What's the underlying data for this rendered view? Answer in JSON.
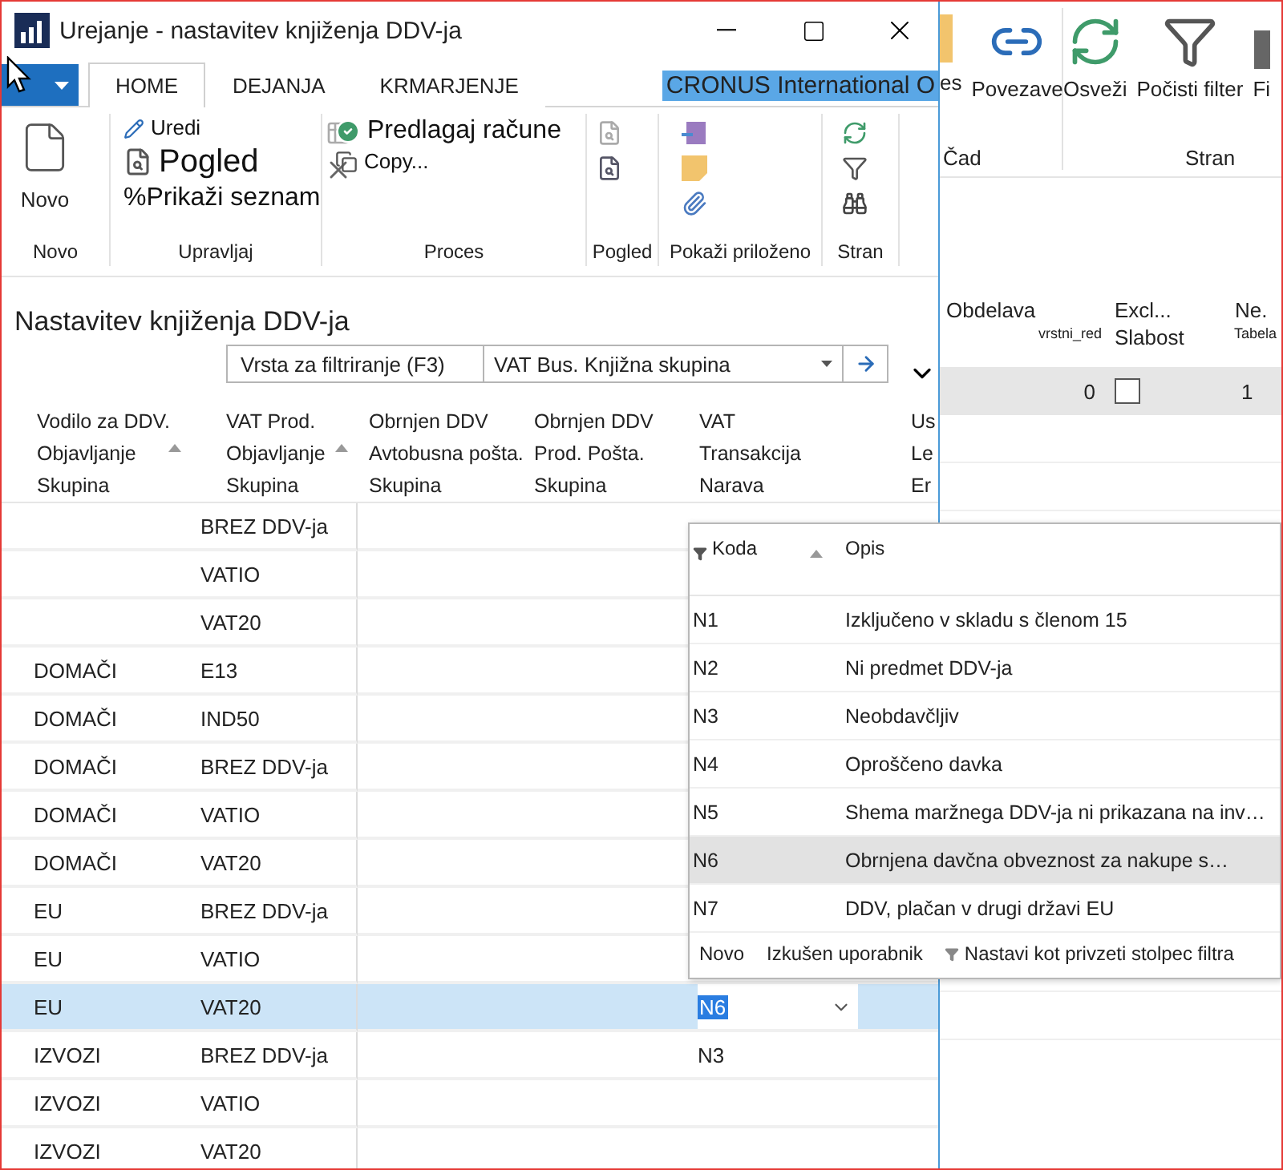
{
  "window": {
    "title": "Urejanje - nastavitev knjiženja DDV-ja"
  },
  "tabs": [
    {
      "label": "HOME",
      "selected": true
    },
    {
      "label": "DEJANJA",
      "selected": false
    },
    {
      "label": "KRMARJENJE",
      "selected": false
    }
  ],
  "company": "CRONUS International O",
  "ribbon": {
    "groups": [
      {
        "label": "Novo",
        "buttons": [
          "Novo"
        ]
      },
      {
        "label": "Upravljaj",
        "buttons": [
          "Uredi",
          "Pogled",
          "%Prikaži seznam"
        ]
      },
      {
        "label": "Proces",
        "buttons": [
          "Predlagaj račune",
          "Copy..."
        ]
      },
      {
        "label": "Pogled"
      },
      {
        "label": "Pokaži priloženo"
      },
      {
        "label": "Stran"
      }
    ]
  },
  "page_title": "Nastavitev knjiženja DDV-ja",
  "filter": {
    "placeholder": "Vrsta za filtriranje (F3)",
    "field": "VAT Bus. Knjižna skupina"
  },
  "table": {
    "columns": [
      {
        "lines": [
          "Vodilo za DDV.",
          "Objavljanje",
          "Skupina"
        ],
        "sort_arrow": true
      },
      {
        "lines": [
          "VAT Prod.",
          "Objavljanje",
          "Skupina"
        ],
        "sort_arrow": true
      },
      {
        "lines": [
          "Obrnjen DDV",
          "Avtobusna pošta.",
          "Skupina"
        ],
        "sort_arrow": false
      },
      {
        "lines": [
          "Obrnjen DDV",
          "Prod. Pošta.",
          "Skupina"
        ],
        "sort_arrow": false
      },
      {
        "lines": [
          "VAT",
          "Transakcija",
          "Narava"
        ],
        "sort_arrow": false
      },
      {
        "lines": [
          "Us",
          "Le",
          "Er"
        ],
        "sort_arrow": false
      }
    ],
    "rows": [
      {
        "cells": [
          "",
          "BREZ DDV-ja",
          "",
          "",
          ""
        ],
        "selected": false
      },
      {
        "cells": [
          "",
          "VATIO",
          "",
          "",
          ""
        ],
        "selected": false
      },
      {
        "cells": [
          "",
          "VAT20",
          "",
          "",
          ""
        ],
        "selected": false
      },
      {
        "cells": [
          "DOMAČI",
          "E13",
          "",
          "",
          ""
        ],
        "selected": false
      },
      {
        "cells": [
          "DOMAČI",
          "IND50",
          "",
          "",
          ""
        ],
        "selected": false
      },
      {
        "cells": [
          "DOMAČI",
          "BREZ DDV-ja",
          "",
          "",
          ""
        ],
        "selected": false
      },
      {
        "cells": [
          "DOMAČI",
          "VATIO",
          "",
          "",
          ""
        ],
        "selected": false
      },
      {
        "cells": [
          "DOMAČI",
          "VAT20",
          "",
          "",
          ""
        ],
        "selected": false
      },
      {
        "cells": [
          "EU",
          "BREZ DDV-ja",
          "",
          "",
          ""
        ],
        "selected": false
      },
      {
        "cells": [
          "EU",
          "VATIO",
          "",
          "",
          ""
        ],
        "selected": false
      },
      {
        "cells": [
          "EU",
          "VAT20",
          "",
          "",
          "N6"
        ],
        "selected": true
      },
      {
        "cells": [
          "IZVOZI",
          "BREZ DDV-ja",
          "",
          "",
          "N3"
        ],
        "selected": false
      },
      {
        "cells": [
          "IZVOZI",
          "VATIO",
          "",
          "",
          ""
        ],
        "selected": false
      },
      {
        "cells": [
          "IZVOZI",
          "VAT20",
          "",
          "",
          ""
        ],
        "selected": false
      }
    ]
  },
  "lookup": {
    "columns": [
      "Koda",
      "Opis"
    ],
    "rows": [
      {
        "code": "N1",
        "description": "Izključeno v skladu s členom 15",
        "selected": false
      },
      {
        "code": "N2",
        "description": "Ni predmet DDV-ja",
        "selected": false
      },
      {
        "code": "N3",
        "description": "Neobdavčljiv",
        "selected": false
      },
      {
        "code": "N4",
        "description": "Oproščeno davka",
        "selected": false
      },
      {
        "code": "N5",
        "description": "Shema maržnega DDV-ja ni prikazana na inv…",
        "selected": false
      },
      {
        "code": "N6",
        "description": "Obrnjena davčna obveznost za nakupe s…",
        "selected": true
      },
      {
        "code": "N7",
        "description": "DDV, plačan v drugi državi EU",
        "selected": false
      }
    ],
    "footer": [
      "Novo",
      "Izkušen uporabnik",
      "Nastavi kot privzeti stolpec filtra"
    ]
  },
  "background_window": {
    "ribbon_groups": [
      {
        "label": "Čad",
        "buttons": [
          "es",
          "Povezave"
        ]
      },
      {
        "label": "Stran",
        "buttons": [
          "Osveži",
          "Počisti filter",
          "Fi"
        ]
      }
    ],
    "columns": [
      {
        "title": "Obdelava",
        "subtitle": "vrstni_red"
      },
      {
        "title": "Excl...",
        "subtitle": "Slabost"
      },
      {
        "title": "Ne.",
        "subtitle": "Tabela"
      }
    ],
    "row": {
      "value": "0",
      "checked": false,
      "number": "1"
    }
  }
}
